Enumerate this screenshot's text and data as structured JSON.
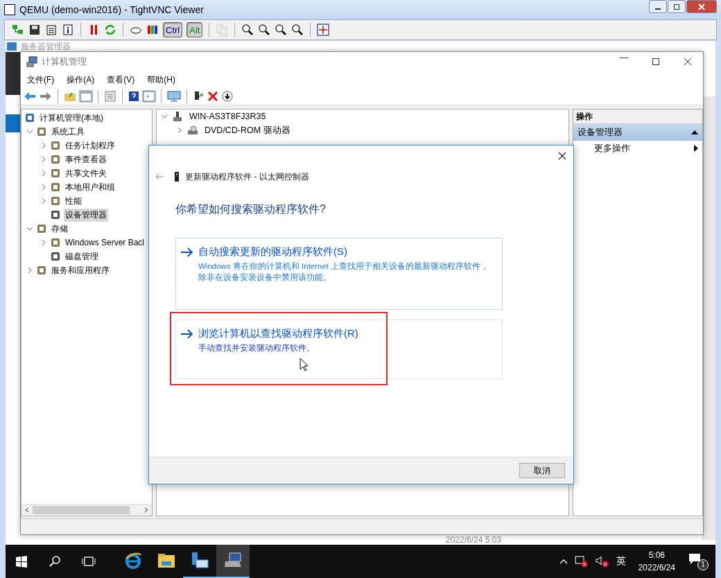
{
  "viewer": {
    "title": "QEMU (demo-win2016) - TightVNC Viewer",
    "keys": [
      {
        "label": "Ctrl",
        "selected": true
      },
      {
        "label": "Alt",
        "selected": true
      }
    ]
  },
  "background_window": {
    "title": "服务器管理器",
    "timestamp": "2022/6/24 5:03"
  },
  "window": {
    "title": "计算机管理",
    "menu": [
      "文件(F)",
      "操作(A)",
      "查看(V)",
      "帮助(H)"
    ],
    "tree": [
      {
        "label": "计算机管理(本地)",
        "kind": "root",
        "selected": false,
        "children": [
          {
            "label": "系统工具",
            "kind": "branch",
            "expanded": true,
            "selected": false,
            "children": [
              {
                "label": "任务计划程序",
                "kind": "branch",
                "expanded": false,
                "selected": false
              },
              {
                "label": "事件查看器",
                "kind": "branch",
                "expanded": false,
                "selected": false
              },
              {
                "label": "共享文件夹",
                "kind": "branch",
                "expanded": false,
                "selected": false
              },
              {
                "label": "本地用户和组",
                "kind": "branch",
                "expanded": false,
                "selected": false
              },
              {
                "label": "性能",
                "kind": "branch",
                "expanded": false,
                "selected": false
              },
              {
                "label": "设备管理器",
                "kind": "leaf",
                "selected": true
              }
            ]
          },
          {
            "label": "存储",
            "kind": "branch",
            "expanded": true,
            "selected": false,
            "children": [
              {
                "label": "Windows Server Bacl",
                "kind": "branch",
                "expanded": false,
                "selected": false
              },
              {
                "label": "磁盘管理",
                "kind": "leaf",
                "selected": false
              }
            ]
          },
          {
            "label": "服务和应用程序",
            "kind": "branch",
            "expanded": false,
            "selected": false
          }
        ]
      }
    ],
    "devices": {
      "label": "WIN-AS3T8FJ3R35",
      "expanded": true,
      "children": [
        {
          "label": "DVD/CD-ROM 驱动器",
          "expanded": false
        }
      ]
    },
    "actions": {
      "header": "操作",
      "section": "设备管理器",
      "expanded": true,
      "items": [
        "更多操作"
      ]
    }
  },
  "dialog": {
    "title": "更新驱动程序软件 - 以太网控制器",
    "heading": "你希望如何搜索驱动程序软件?",
    "options": [
      {
        "title": "自动搜索更新的驱动程序软件(S)",
        "description": "Windows 将在你的计算机和 Internet 上查找用于相关设备的最新驱动程序软件，除非在设备安装设备中禁用该功能。",
        "annotated": false
      },
      {
        "title": "浏览计算机以查找驱动程序软件(R)",
        "description": "手动查找并安装驱动程序软件。",
        "annotated": true
      }
    ],
    "cancel": "取消"
  },
  "taskbar": {
    "apps": [
      {
        "kind": "browser",
        "running": false,
        "selected": false
      },
      {
        "kind": "folder",
        "running": false,
        "selected": false
      },
      {
        "kind": "server",
        "running": true,
        "selected": false
      },
      {
        "kind": "computer",
        "running": true,
        "selected": true
      }
    ],
    "language": "英",
    "time": "5:06",
    "date": "2022/6/24",
    "notifications": "1"
  }
}
